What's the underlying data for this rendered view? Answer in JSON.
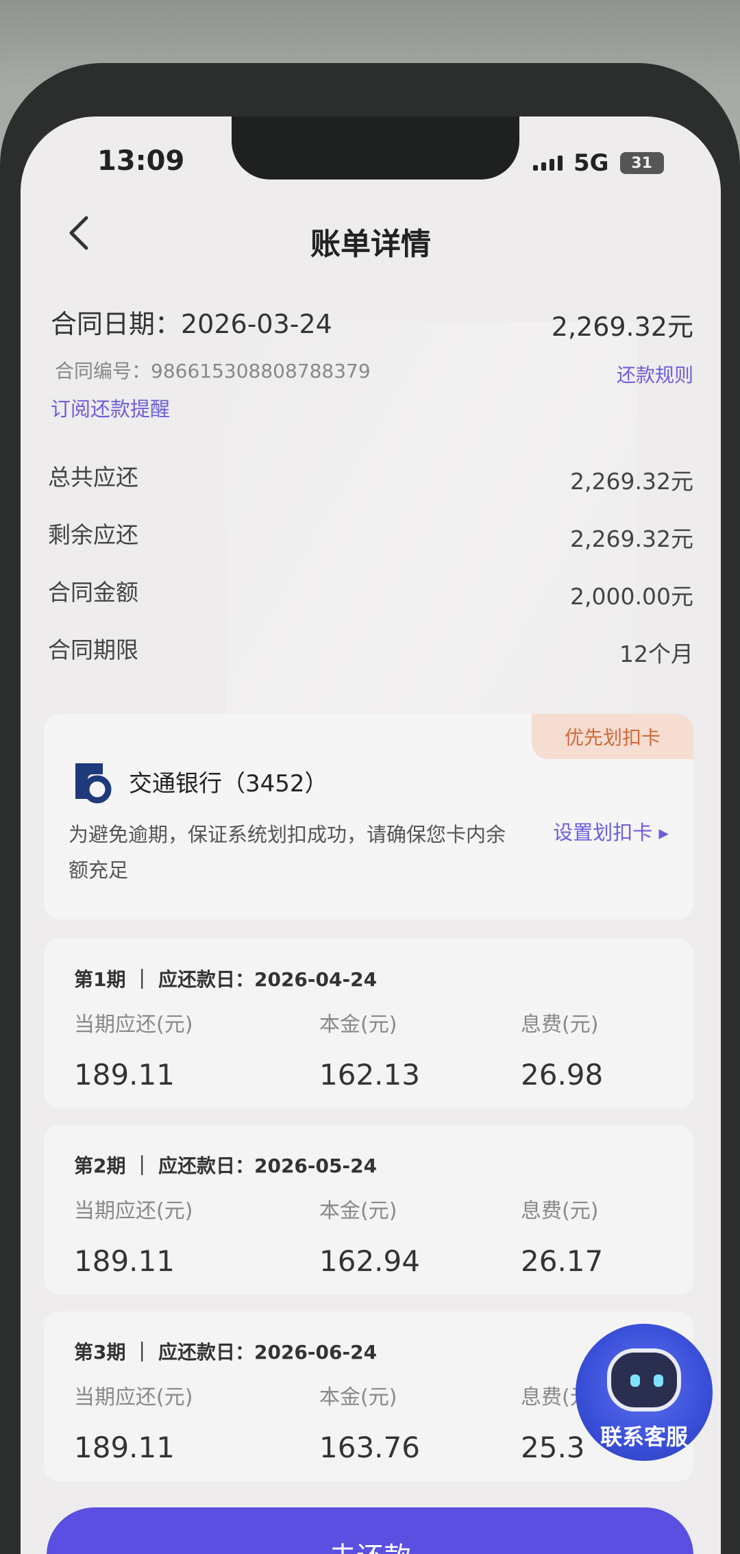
{
  "status_bar": {
    "time": "13:09",
    "network": "5G",
    "battery": "31"
  },
  "header": {
    "title": "账单详情"
  },
  "contract": {
    "date_line": "合同日期：2026-03-24",
    "amount": "2,269.32元",
    "number_line": "合同编号：9866153088087883​79",
    "repay_rules_link": "还款规则",
    "subscribe_link": "订阅还款提醒"
  },
  "summary": [
    {
      "label": "总共应还",
      "value": "2,269.32元"
    },
    {
      "label": "剩余应还",
      "value": "2,269.32元"
    },
    {
      "label": "合同金额",
      "value": "2,000.00元"
    },
    {
      "label": "合同期限",
      "value": "12个月"
    }
  ],
  "card": {
    "badge": "优先划扣卡",
    "bank_name": "交通银行（3452）",
    "note": "为避免逾期，保证系统划扣成功，请确保您卡内余额充足",
    "set_card_link": "设置划扣卡 ▸"
  },
  "columns": {
    "due": "当期应还(元)",
    "principal": "本金(元)",
    "interest": "息费(元)",
    "interest_cut": "息费(元"
  },
  "installments": [
    {
      "head": "第1期 ｜ 应还款日：2026-04-24",
      "due": "189.11",
      "principal": "162.13",
      "interest": "26.98"
    },
    {
      "head": "第2期 ｜ 应还款日：2026-05-24",
      "due": "189.11",
      "principal": "162.94",
      "interest": "26.17"
    },
    {
      "head": "第3期 ｜ 应还款日：2026-06-24",
      "due": "189.11",
      "principal": "163.76",
      "interest": "25.3"
    }
  ],
  "assistant": {
    "label": "联系客服"
  },
  "bottom_button": {
    "label": "去还款"
  },
  "colors": {
    "accent": "#6b5fd8",
    "badge_bg": "#f6ddd2",
    "badge_text": "#d06a3a",
    "button": "#5a4fe0"
  }
}
